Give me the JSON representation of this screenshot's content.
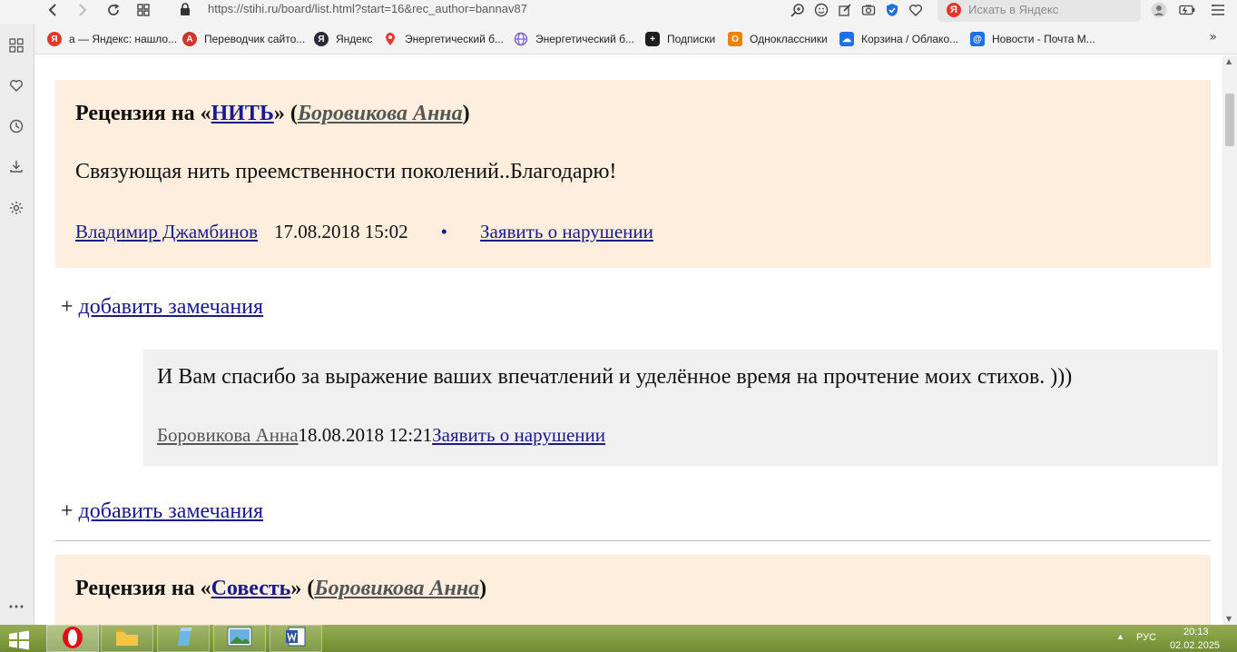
{
  "browser": {
    "url": "https://stihi.ru/board/list.html?start=16&rec_author=bannav87",
    "search_placeholder": "Искать в Яндекс",
    "search_logo": "Я"
  },
  "bookmarks": [
    {
      "label": "а — Яндекс: нашло...",
      "icon": "yandex-icon",
      "color": "#e8352a",
      "glyph": "Я"
    },
    {
      "label": "Переводчик сайто...",
      "icon": "translator-icon",
      "color": "#c93a2b",
      "glyph": "A"
    },
    {
      "label": "Яндекс",
      "icon": "yandex-icon",
      "color": "#2a2a3a",
      "glyph": "Я"
    },
    {
      "label": "Энергетический б...",
      "icon": "map-pin-icon",
      "color": "#e5382b",
      "glyph": "●"
    },
    {
      "label": "Энергетический б...",
      "icon": "globe-icon",
      "color": "#7b5fc9",
      "glyph": "⊕"
    },
    {
      "label": "Подписки",
      "icon": "subscriptions-icon",
      "color": "#1e1e1e",
      "glyph": "+"
    },
    {
      "label": "Одноклассники",
      "icon": "odnoklassniki-icon",
      "color": "#ee8208",
      "glyph": "О"
    },
    {
      "label": "Корзина / Облако...",
      "icon": "cloud-icon",
      "color": "#1f6fe5",
      "glyph": "☁"
    },
    {
      "label": "Новости - Почта М...",
      "icon": "mail-icon",
      "color": "#1f6fe5",
      "glyph": "@"
    }
  ],
  "reviews": [
    {
      "title_prefix": "Рецензия на «",
      "work": "НИТЬ",
      "title_mid": "» (",
      "author": "Боровикова Анна",
      "title_suffix": ")",
      "text": "Связующая нить преемственности поколений..Благодарю!",
      "reviewer": "Владимир Джамбинов",
      "date": "17.08.2018 15:02",
      "bullet": "•",
      "report": "Заявить о нарушении"
    },
    {
      "title_prefix": "Рецензия на «",
      "work": "Совесть",
      "title_mid": "» (",
      "author": "Боровикова Анна",
      "title_suffix": ")"
    }
  ],
  "reply": {
    "text": "И Вам спасибо за выражение ваших впечатлений и уделённое время на прочтение моих стихов. )))",
    "author": "Боровикова Анна",
    "date": "18.08.2018 12:21",
    "report": "Заявить о нарушении"
  },
  "add_remark": {
    "plus": "+ ",
    "label": "добавить замечания"
  },
  "taskbar": {
    "lang": "РУС",
    "time": "20:13",
    "date": "02.02.2025"
  }
}
